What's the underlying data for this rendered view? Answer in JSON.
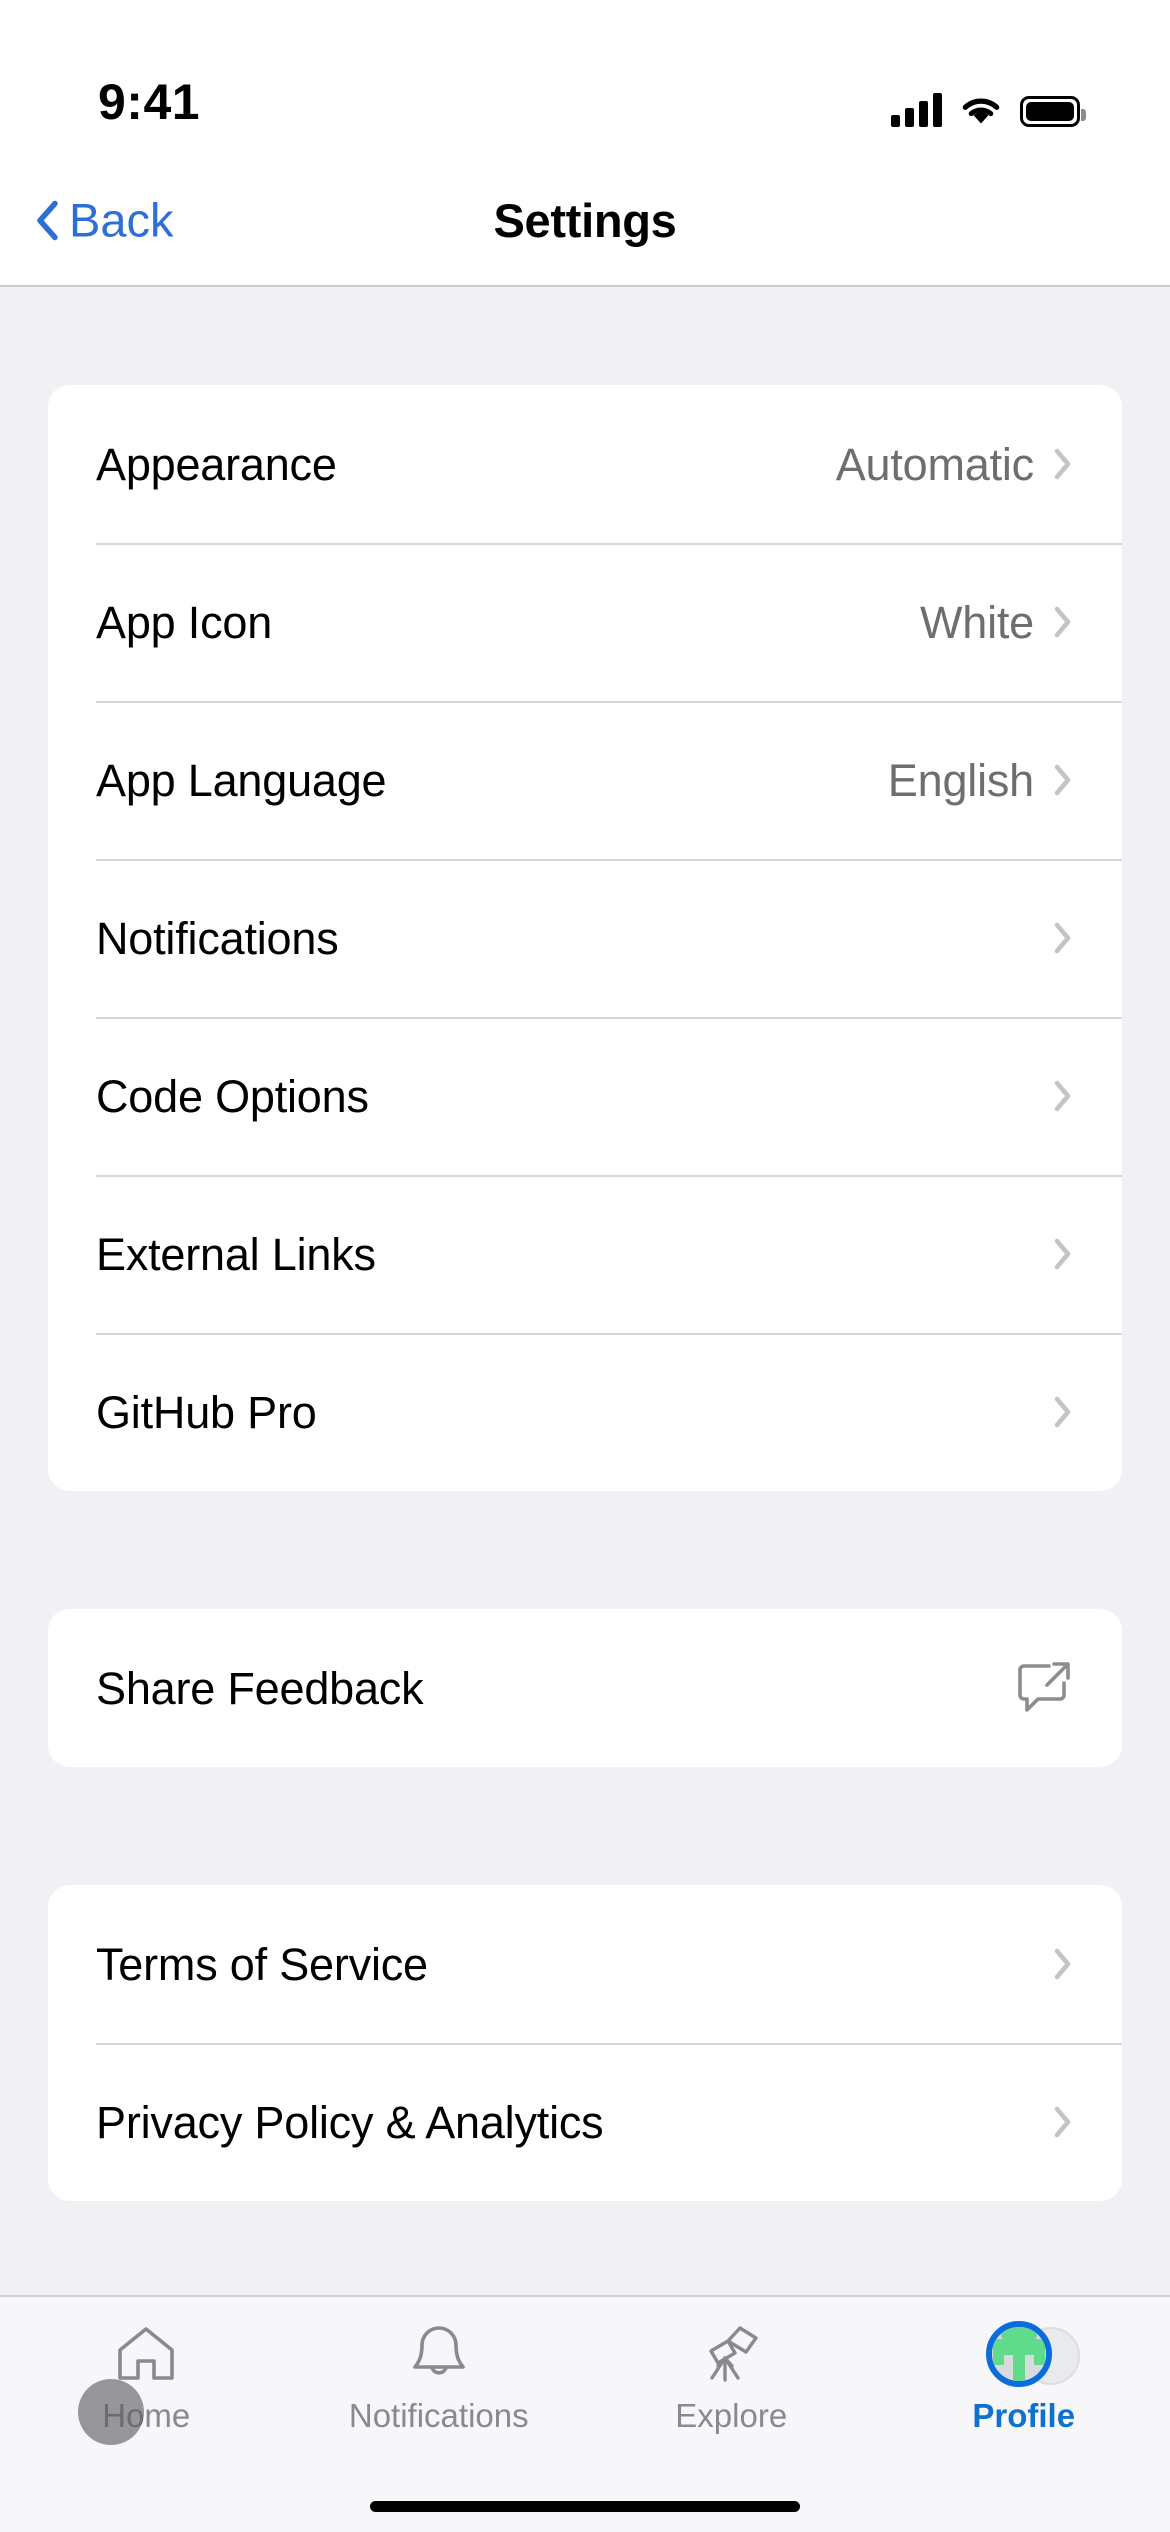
{
  "status_bar": {
    "time": "9:41",
    "cellular_icon": "cellular-signal-icon",
    "wifi_icon": "wifi-icon",
    "battery_icon": "battery-full-icon"
  },
  "nav_bar": {
    "back_label": "Back",
    "title": "Settings",
    "back_icon": "chevron-left-icon",
    "accent_color": "#2E6FD6"
  },
  "sections": [
    {
      "id": "preferences",
      "rows": [
        {
          "label": "Appearance",
          "value": "Automatic",
          "accessory": "chevron-right-icon"
        },
        {
          "label": "App Icon",
          "value": "White",
          "accessory": "chevron-right-icon"
        },
        {
          "label": "App Language",
          "value": "English",
          "accessory": "chevron-right-icon"
        },
        {
          "label": "Notifications",
          "value": "",
          "accessory": "chevron-right-icon"
        },
        {
          "label": "Code Options",
          "value": "",
          "accessory": "chevron-right-icon"
        },
        {
          "label": "External Links",
          "value": "",
          "accessory": "chevron-right-icon"
        },
        {
          "label": "GitHub Pro",
          "value": "",
          "accessory": "chevron-right-icon"
        }
      ]
    },
    {
      "id": "feedback",
      "rows": [
        {
          "label": "Share Feedback",
          "value": "",
          "accessory": "share-bubble-icon"
        }
      ]
    },
    {
      "id": "legal",
      "rows": [
        {
          "label": "Terms of Service",
          "value": "",
          "accessory": "chevron-right-icon"
        },
        {
          "label": "Privacy Policy & Analytics",
          "value": "",
          "accessory": "chevron-right-icon"
        }
      ]
    }
  ],
  "tab_bar": {
    "tabs": [
      {
        "label": "Home",
        "icon": "house-icon",
        "active": false
      },
      {
        "label": "Notifications",
        "icon": "bell-icon",
        "active": false
      },
      {
        "label": "Explore",
        "icon": "telescope-icon",
        "active": false
      },
      {
        "label": "Profile",
        "icon": "avatar-icon",
        "active": true
      }
    ],
    "active_color": "#1070CE",
    "inactive_color": "#8A8A8E"
  },
  "overlay": {
    "touch_indicator": "touch-point-indicator"
  },
  "home_indicator": "home-indicator"
}
